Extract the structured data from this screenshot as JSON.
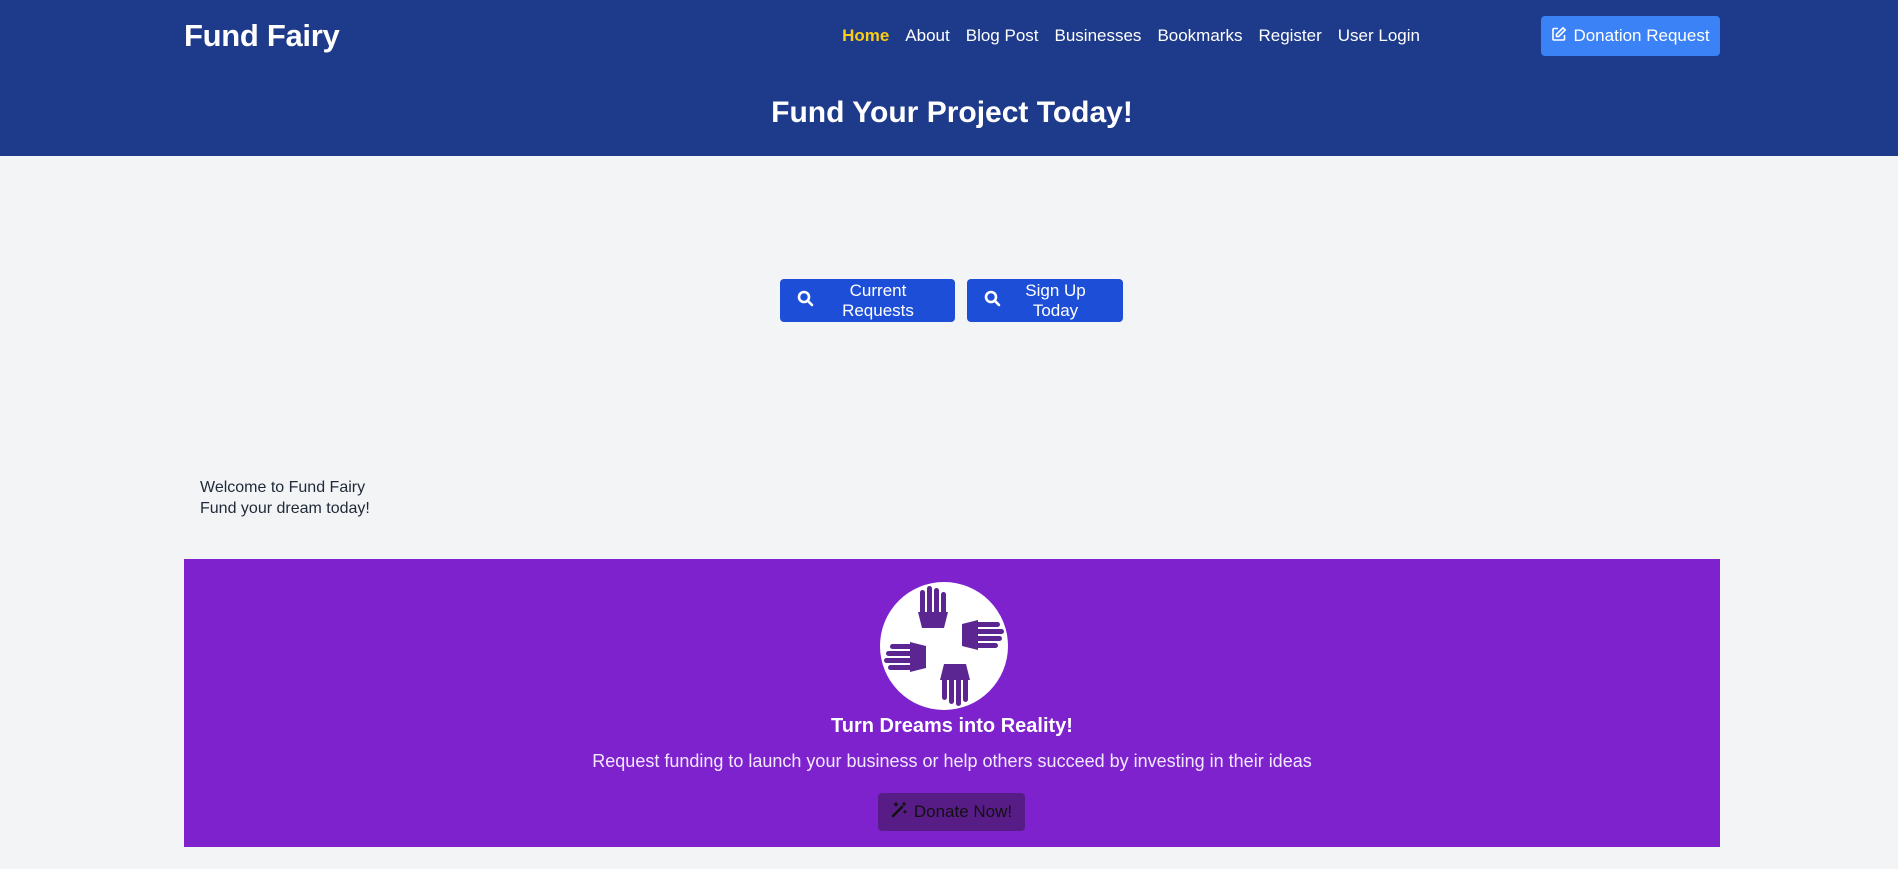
{
  "header": {
    "brand": "Fund Fairy",
    "nav": [
      {
        "label": "Home",
        "active": true
      },
      {
        "label": "About"
      },
      {
        "label": "Blog Post"
      },
      {
        "label": "Businesses"
      },
      {
        "label": "Bookmarks"
      },
      {
        "label": "Register"
      },
      {
        "label": "User Login"
      }
    ],
    "donation_button": {
      "label": "Donation Request",
      "icon": "edit-icon"
    },
    "hero_title": "Fund Your Project Today!"
  },
  "cta": {
    "current_requests": {
      "label": "Current Requests",
      "icon": "search-icon"
    },
    "sign_up": {
      "label": "Sign Up Today",
      "icon": "search-icon"
    }
  },
  "welcome": {
    "line1": "Welcome to Fund Fairy",
    "line2": "Fund your dream today!"
  },
  "promo": {
    "logo_icon": "hands-heart-icon",
    "title": "Turn Dreams into Reality!",
    "subtitle": "Request funding to launch your business or help others succeed by investing in their ideas",
    "button": {
      "label": "Donate Now!",
      "icon": "magic-wand-icon"
    }
  },
  "colors": {
    "header_bg": "#1e3a8a",
    "active_nav": "#facc15",
    "primary_button": "#1d4ed8",
    "donation_button": "#3b82f6",
    "promo_bg": "#7e22ce",
    "donate_now_bg": "#581c87",
    "page_bg": "#f3f4f6"
  }
}
